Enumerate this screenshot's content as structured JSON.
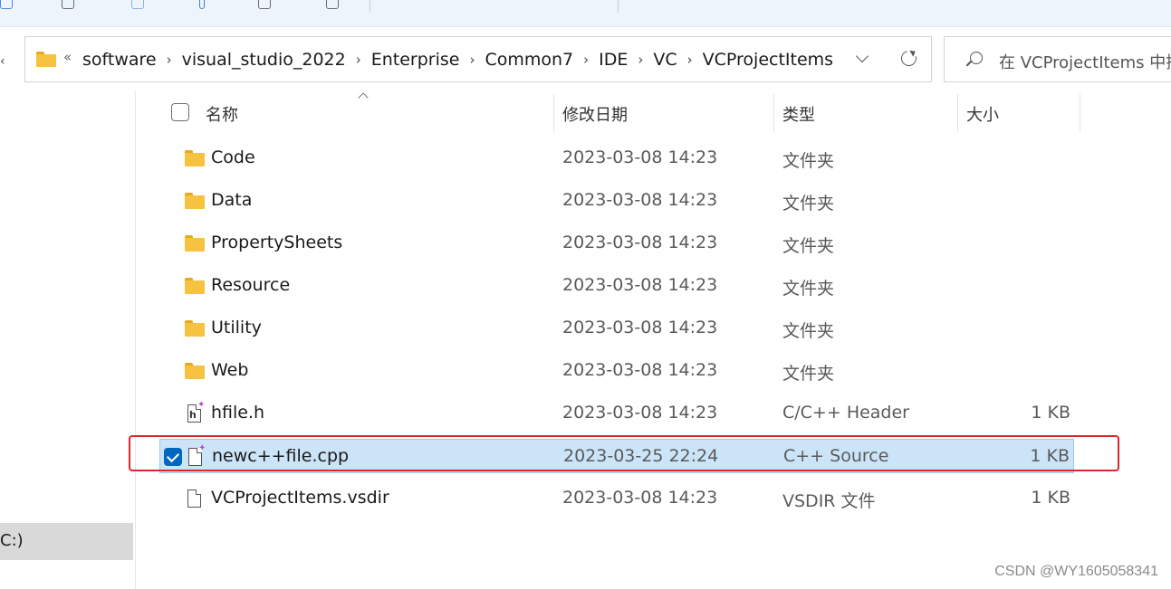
{
  "address_bar": {
    "overflow": "«",
    "breadcrumbs": [
      "software",
      "visual_studio_2022",
      "Enterprise",
      "Common7",
      "IDE",
      "VC",
      "VCProjectItems"
    ],
    "separator": "›"
  },
  "search": {
    "placeholder": "在 VCProjectItems 中搜索"
  },
  "nav_pane": {
    "drive_label": "C:)"
  },
  "columns": {
    "name": "名称",
    "date_modified": "修改日期",
    "type": "类型",
    "size": "大小"
  },
  "files": [
    {
      "name": "Code",
      "date": "2023-03-08 14:23",
      "type": "文件夹",
      "size": "",
      "icon": "folder-icon",
      "selected": false
    },
    {
      "name": "Data",
      "date": "2023-03-08 14:23",
      "type": "文件夹",
      "size": "",
      "icon": "folder-icon",
      "selected": false
    },
    {
      "name": "PropertySheets",
      "date": "2023-03-08 14:23",
      "type": "文件夹",
      "size": "",
      "icon": "folder-icon",
      "selected": false
    },
    {
      "name": "Resource",
      "date": "2023-03-08 14:23",
      "type": "文件夹",
      "size": "",
      "icon": "folder-icon",
      "selected": false
    },
    {
      "name": "Utility",
      "date": "2023-03-08 14:23",
      "type": "文件夹",
      "size": "",
      "icon": "folder-icon",
      "selected": false
    },
    {
      "name": "Web",
      "date": "2023-03-08 14:23",
      "type": "文件夹",
      "size": "",
      "icon": "folder-icon",
      "selected": false
    },
    {
      "name": "hfile.h",
      "date": "2023-03-08 14:23",
      "type": "C/C++ Header",
      "size": "1 KB",
      "icon": "header-file-icon",
      "selected": false
    },
    {
      "name": "newc++file.cpp",
      "date": "2023-03-25 22:24",
      "type": "C++ Source",
      "size": "1 KB",
      "icon": "cpp-file-icon",
      "selected": true
    },
    {
      "name": "VCProjectItems.vsdir",
      "date": "2023-03-08 14:23",
      "type": "VSDIR 文件",
      "size": "1 KB",
      "icon": "file-icon",
      "selected": false
    }
  ],
  "highlight_color": "#e0262b",
  "selection_color": "#cce4f7",
  "watermark": "CSDN @WY1605058341"
}
